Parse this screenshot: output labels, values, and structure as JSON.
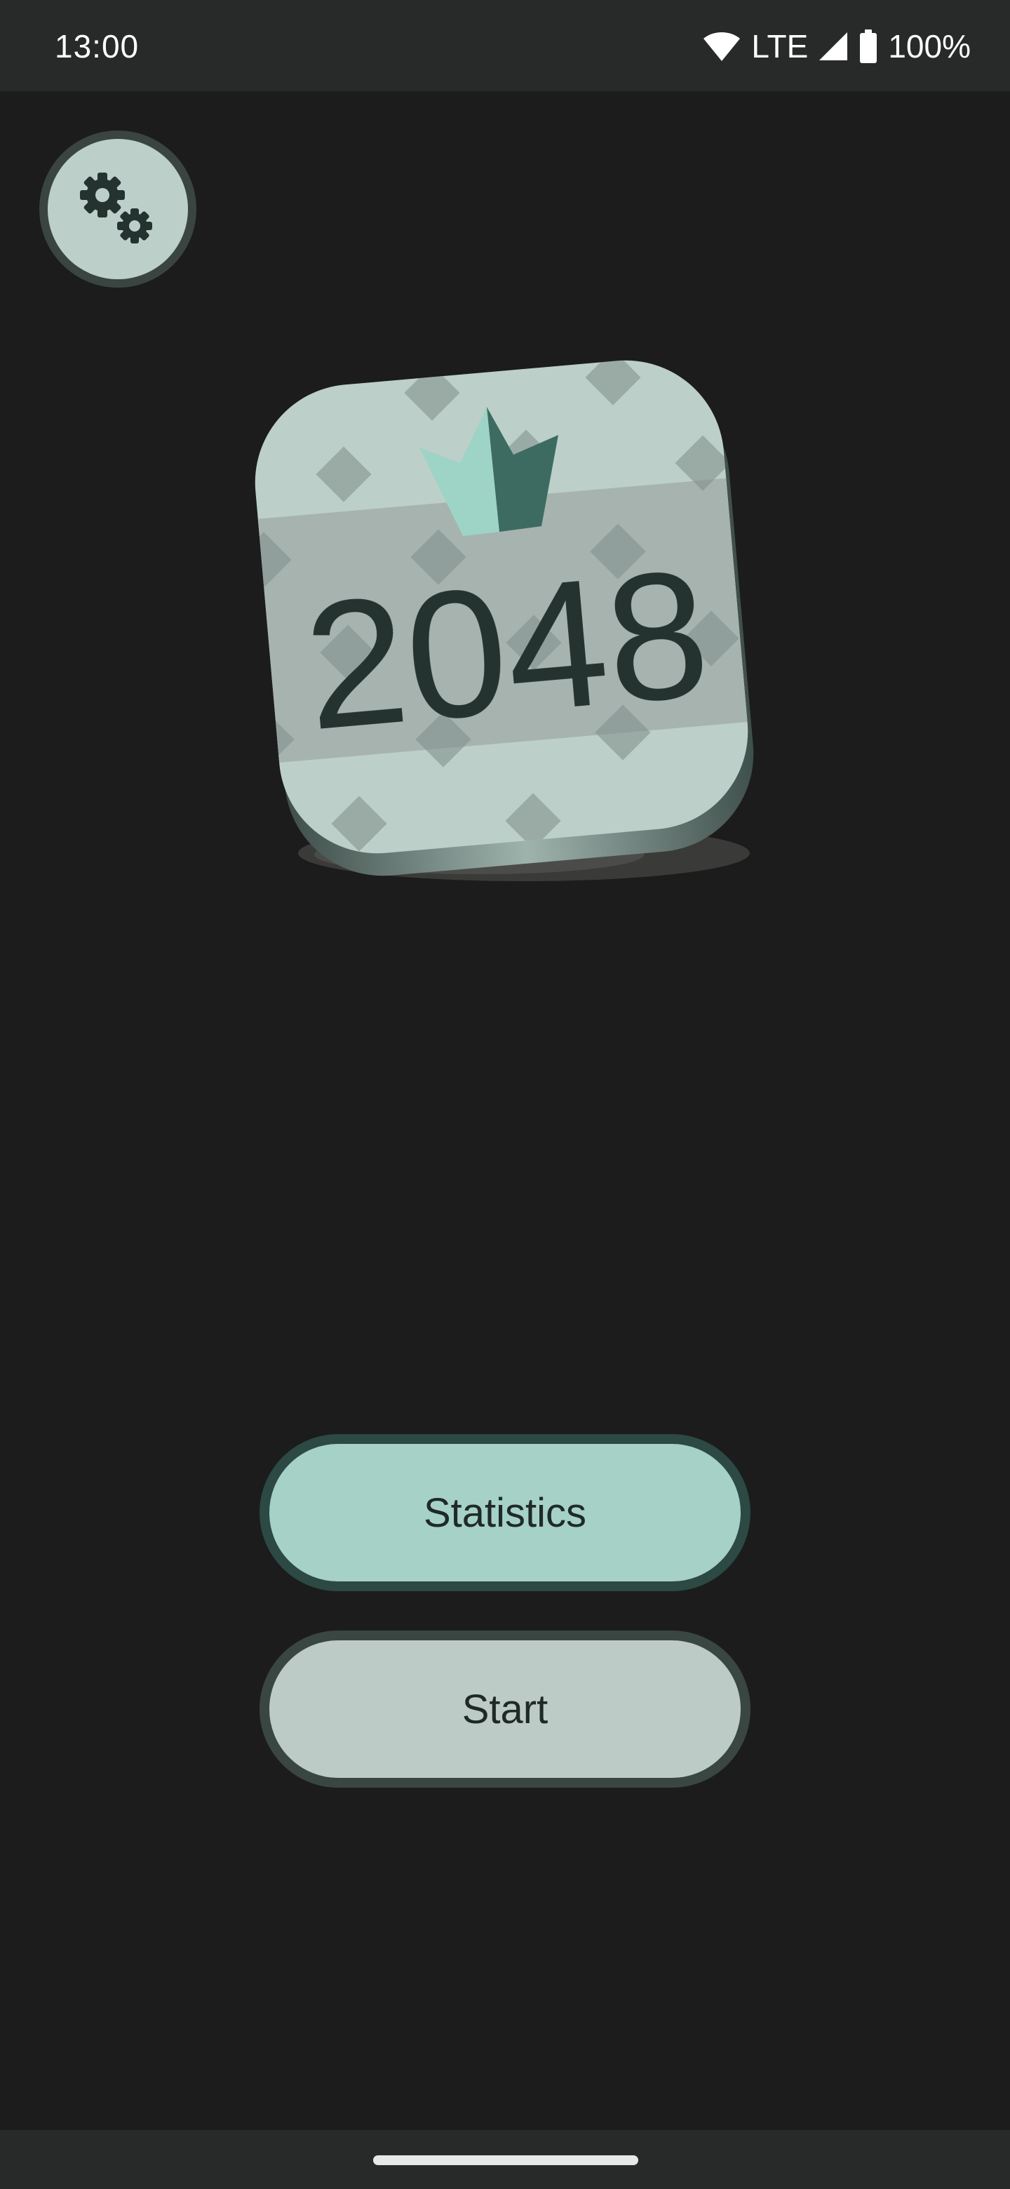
{
  "status_bar": {
    "time": "13:00",
    "network": "LTE",
    "battery": "100%",
    "icons": [
      "wifi-icon",
      "signal-icon",
      "battery-icon"
    ]
  },
  "settings": {
    "icon": "gears-icon"
  },
  "logo": {
    "text": "2048",
    "icon": "crown-icon"
  },
  "buttons": {
    "statistics_label": "Statistics",
    "start_label": "Start"
  },
  "colors": {
    "background": "#1b1c1b",
    "system_bars": "#282a29",
    "statistics_button": "#a6d1c6",
    "start_button": "#bccbc5",
    "tile_face": "#bccfc8",
    "accent_dark": "#3d6b62",
    "accent_light": "#9ed4c6"
  }
}
